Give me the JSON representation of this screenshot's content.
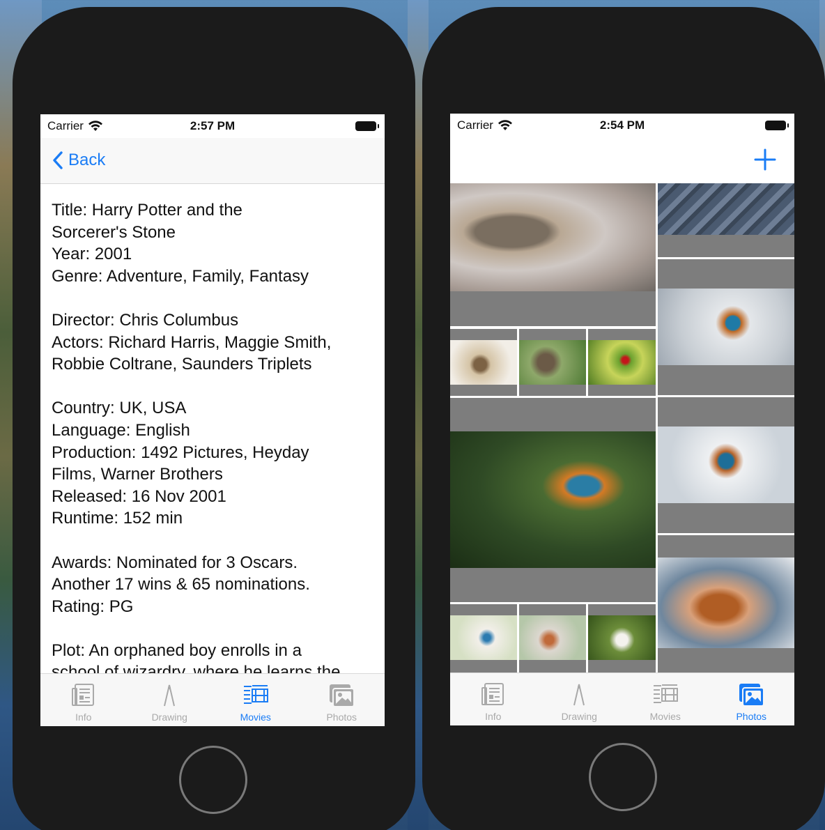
{
  "left_phone": {
    "status": {
      "carrier": "Carrier",
      "time": "2:57 PM"
    },
    "nav": {
      "back_label": "Back"
    },
    "details": [
      "Title: Harry Potter and the",
      "Sorcerer's Stone",
      "Year: 2001",
      "Genre: Adventure, Family, Fantasy",
      "",
      "Director: Chris Columbus",
      "Actors: Richard Harris, Maggie Smith,",
      "Robbie Coltrane, Saunders Triplets",
      "",
      "Country: UK, USA",
      "Language: English",
      "Production: 1492 Pictures, Heyday",
      "Films, Warner Brothers",
      "Released: 16 Nov 2001",
      "Runtime: 152 min",
      "",
      "Awards: Nominated for 3 Oscars.",
      "Another 17 wins & 65 nominations.",
      "Rating: PG",
      "",
      "Plot: An orphaned boy enrolls in a",
      "school of wizardry, where he learns the"
    ],
    "tabs": [
      {
        "label": "Info",
        "icon": "info-icon"
      },
      {
        "label": "Drawing",
        "icon": "drawing-icon"
      },
      {
        "label": "Movies",
        "icon": "movies-icon"
      },
      {
        "label": "Photos",
        "icon": "photos-icon"
      }
    ],
    "active_tab": "Movies"
  },
  "right_phone": {
    "status": {
      "carrier": "Carrier",
      "time": "2:54 PM"
    },
    "nav": {
      "add_icon": "plus-icon"
    },
    "photos": [
      "hedgehog",
      "cat",
      "owl",
      "owl",
      "ladybug",
      "kingfisher",
      "kingfisher",
      "kingfisher",
      "squirrel",
      "bird",
      "bird",
      "dog"
    ],
    "tabs": [
      {
        "label": "Info",
        "icon": "info-icon"
      },
      {
        "label": "Drawing",
        "icon": "drawing-icon"
      },
      {
        "label": "Movies",
        "icon": "movies-icon"
      },
      {
        "label": "Photos",
        "icon": "photos-icon"
      }
    ],
    "active_tab": "Photos"
  },
  "colors": {
    "accent": "#1a7cf5",
    "inactive_tab": "#a9a9a9",
    "cell_fill": "#7d7d7d",
    "phone_body": "#1b1b1b"
  }
}
